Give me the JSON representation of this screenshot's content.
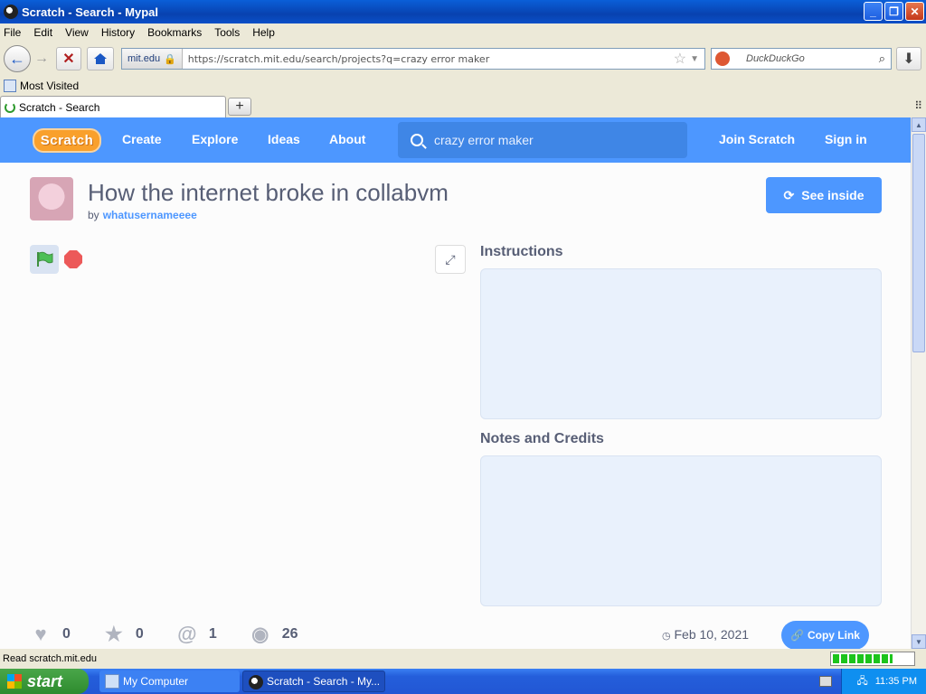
{
  "window": {
    "title": "Scratch - Search - Mypal"
  },
  "menu": [
    "File",
    "Edit",
    "View",
    "History",
    "Bookmarks",
    "Tools",
    "Help"
  ],
  "urlbar": {
    "identity": "mit.edu",
    "url": "https://scratch.mit.edu/search/projects?q=crazy error maker"
  },
  "searchbar": {
    "placeholder": "DuckDuckGo"
  },
  "bookmarks": {
    "most_visited": "Most Visited"
  },
  "tabs": [
    {
      "label": "Scratch - Search"
    }
  ],
  "scratch": {
    "logo": "Scratch",
    "nav": {
      "create": "Create",
      "explore": "Explore",
      "ideas": "Ideas",
      "about": "About",
      "join": "Join Scratch",
      "signin": "Sign in"
    },
    "search_query": "crazy error maker",
    "project": {
      "title": "How the internet broke in collabvm",
      "by": "by",
      "author": "whatusernameeee",
      "see_inside": "See inside",
      "instructions_label": "Instructions",
      "notes_label": "Notes and Credits",
      "stats": {
        "loves": "0",
        "favorites": "0",
        "remixes": "1",
        "views": "26"
      },
      "date": "Feb 10, 2021",
      "copy_link": "Copy Link"
    }
  },
  "status": {
    "text": "Read scratch.mit.edu",
    "progress": 0.75
  },
  "taskbar": {
    "start": "start",
    "items": [
      {
        "label": "My Computer"
      },
      {
        "label": "Scratch - Search - My..."
      }
    ],
    "clock": "11:35 PM"
  }
}
